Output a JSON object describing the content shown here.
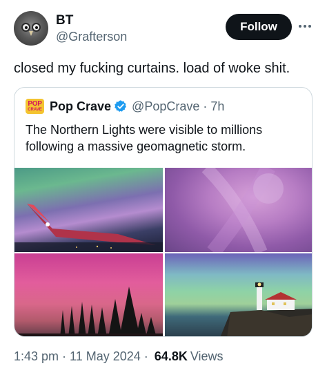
{
  "author": {
    "name": "BT",
    "handle": "@Grafterson",
    "follow_label": "Follow"
  },
  "tweet": {
    "text": "closed my fucking curtains. load of woke shit."
  },
  "quote": {
    "avatar_line1": "POP",
    "avatar_line2": "CRAVE",
    "name": "Pop Crave",
    "handle_time": "@PopCrave · 7h",
    "text": "The Northern Lights were visible to millions following a massive geomagnetic storm."
  },
  "footer": {
    "time": "1:43 pm",
    "date": "11 May 2024",
    "views_count": "64.8K",
    "views_label": "Views"
  },
  "colors": {
    "verified": "#1d9bf0",
    "follow_bg": "#0f1419",
    "secondary_text": "#536471"
  }
}
